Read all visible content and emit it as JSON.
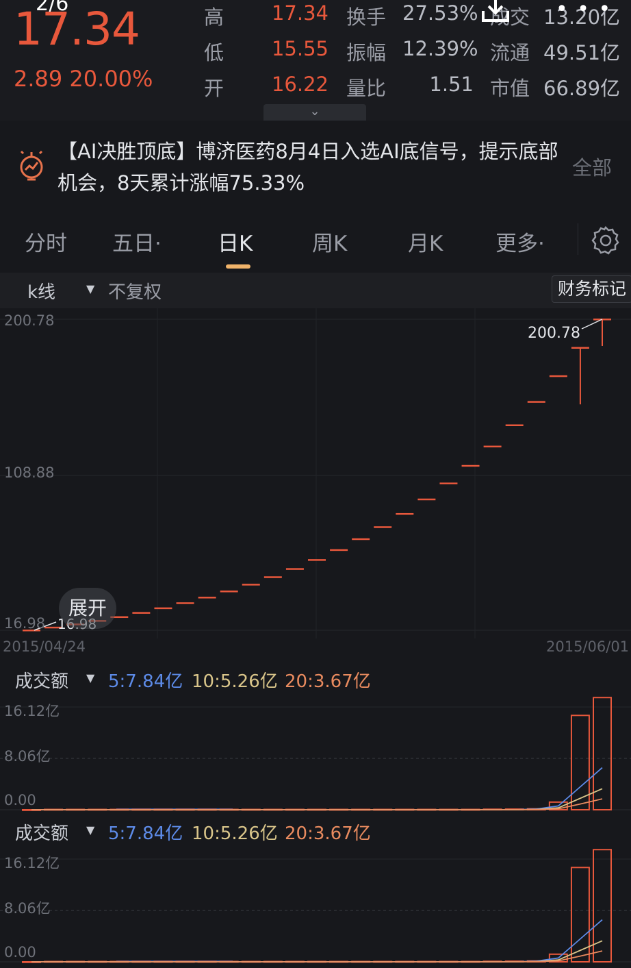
{
  "quote": {
    "page_index": "2/6",
    "price": "17.34",
    "change": "2.89",
    "change_pct": "20.00%",
    "rows": [
      {
        "label": "高",
        "value": "17.34",
        "label2": "换手",
        "value2": "27.53%",
        "label3": "成交",
        "value3": "13.20亿"
      },
      {
        "label": "低",
        "value": "15.55",
        "label2": "振幅",
        "value2": "12.39%",
        "label3": "流通",
        "value3": "49.51亿"
      },
      {
        "label": "开",
        "value": "16.22",
        "label2": "量比",
        "value2": "1.51",
        "label3": "市值",
        "value3": "66.89亿"
      }
    ],
    "expand_glyph": "⌄"
  },
  "icons": {
    "download": "download-icon",
    "more": "more-icon",
    "bulb": "ai-signal-icon",
    "settings": "gear-icon"
  },
  "banner": {
    "text": "【AI决胜顶底】博济医药8月4日入选AI底信号，提示底部机会，8天累计涨幅75.33%",
    "all_label": "全部"
  },
  "tabs": [
    {
      "label": "分时",
      "active": false
    },
    {
      "label": "五日·",
      "active": false
    },
    {
      "label": "日K",
      "active": true
    },
    {
      "label": "周K",
      "active": false
    },
    {
      "label": "月K",
      "active": false
    },
    {
      "label": "更多·",
      "active": false
    }
  ],
  "kline_header": {
    "type_label": "k线",
    "adjust_label": "不复权",
    "finance_mark_label": "财务标记"
  },
  "expand_button": "展开",
  "volume_panels": [
    {
      "label": "成交额",
      "ma5": "5:7.84亿",
      "ma10": "10:5.26亿",
      "ma20": "20:3.67亿",
      "ticks": [
        "16.12亿",
        "8.06亿",
        "0.00"
      ]
    },
    {
      "label": "成交额",
      "ma5": "5:7.84亿",
      "ma10": "10:5.26亿",
      "ma20": "20:3.67亿",
      "ticks": [
        "16.12亿",
        "8.06亿",
        "0.00"
      ]
    }
  ],
  "colors": {
    "up": "#e8583c",
    "accent": "#f0b36a",
    "ma5": "#5d8be8",
    "ma10": "#d9c58a",
    "ma20": "#e98b5f"
  },
  "chart_data": {
    "type": "candlestick",
    "y_ticks": [
      "200.78",
      "108.88",
      "16.98"
    ],
    "ylim": [
      16.98,
      200.78
    ],
    "x_labels": [
      "2015/04/24",
      "2015/06/01"
    ],
    "max_label": "200.78",
    "min_label": "16.98",
    "candles": [
      {
        "o": 16.98,
        "h": 16.98,
        "l": 16.98,
        "c": 16.98
      },
      {
        "o": 18.68,
        "h": 18.68,
        "l": 18.68,
        "c": 18.68
      },
      {
        "o": 20.55,
        "h": 20.55,
        "l": 20.55,
        "c": 20.55
      },
      {
        "o": 22.6,
        "h": 22.6,
        "l": 22.6,
        "c": 22.6
      },
      {
        "o": 24.86,
        "h": 24.86,
        "l": 24.86,
        "c": 24.86
      },
      {
        "o": 27.35,
        "h": 27.35,
        "l": 27.35,
        "c": 27.35
      },
      {
        "o": 30.08,
        "h": 30.08,
        "l": 30.08,
        "c": 30.08
      },
      {
        "o": 33.09,
        "h": 33.09,
        "l": 33.09,
        "c": 33.09
      },
      {
        "o": 36.4,
        "h": 36.4,
        "l": 36.4,
        "c": 36.4
      },
      {
        "o": 40.04,
        "h": 40.04,
        "l": 40.04,
        "c": 40.04
      },
      {
        "o": 44.04,
        "h": 44.04,
        "l": 44.04,
        "c": 44.04
      },
      {
        "o": 48.45,
        "h": 48.45,
        "l": 48.45,
        "c": 48.45
      },
      {
        "o": 53.29,
        "h": 53.29,
        "l": 53.29,
        "c": 53.29
      },
      {
        "o": 58.62,
        "h": 58.62,
        "l": 58.62,
        "c": 58.62
      },
      {
        "o": 64.48,
        "h": 64.48,
        "l": 64.48,
        "c": 64.48
      },
      {
        "o": 70.93,
        "h": 70.93,
        "l": 70.93,
        "c": 70.93
      },
      {
        "o": 78.02,
        "h": 78.02,
        "l": 78.02,
        "c": 78.02
      },
      {
        "o": 85.83,
        "h": 85.83,
        "l": 85.83,
        "c": 85.83
      },
      {
        "o": 94.41,
        "h": 94.41,
        "l": 94.41,
        "c": 94.41
      },
      {
        "o": 103.85,
        "h": 103.85,
        "l": 103.85,
        "c": 103.85
      },
      {
        "o": 114.24,
        "h": 114.24,
        "l": 114.24,
        "c": 114.24
      },
      {
        "o": 125.66,
        "h": 125.66,
        "l": 125.66,
        "c": 125.66
      },
      {
        "o": 138.23,
        "h": 138.23,
        "l": 138.23,
        "c": 138.23
      },
      {
        "o": 152.05,
        "h": 152.05,
        "l": 152.05,
        "c": 152.05
      },
      {
        "o": 167.25,
        "h": 167.25,
        "l": 167.25,
        "c": 167.25
      },
      {
        "o": 183.98,
        "h": 183.98,
        "l": 150.5,
        "c": 183.98
      },
      {
        "o": 200.78,
        "h": 200.78,
        "l": 185.0,
        "c": 200.78
      }
    ],
    "volume": {
      "ylim": [
        0,
        16.12
      ],
      "unit": "亿",
      "bars": [
        0,
        0.05,
        0.05,
        0.05,
        0.05,
        0.05,
        0.05,
        0.05,
        0.05,
        0.05,
        0.05,
        0.05,
        0.05,
        0.05,
        0.05,
        0.05,
        0.05,
        0.05,
        0.05,
        0.05,
        0.05,
        0.08,
        0.1,
        0.15,
        1.2,
        14.8,
        17.6
      ],
      "ma5": [
        0,
        0,
        0,
        0,
        0,
        0,
        0,
        0,
        0,
        0,
        0,
        0,
        0,
        0,
        0,
        0,
        0,
        0,
        0,
        0,
        0,
        0,
        0,
        0.1,
        0.6,
        3.6,
        6.6
      ],
      "ma10": [
        0,
        0,
        0,
        0,
        0,
        0,
        0,
        0,
        0,
        0,
        0,
        0,
        0,
        0,
        0,
        0,
        0,
        0,
        0,
        0,
        0,
        0,
        0,
        0.05,
        0.3,
        1.8,
        3.3
      ],
      "ma20": [
        0,
        0,
        0,
        0,
        0,
        0,
        0,
        0,
        0,
        0,
        0,
        0,
        0,
        0,
        0,
        0,
        0,
        0,
        0,
        0,
        0,
        0,
        0,
        0.03,
        0.15,
        0.9,
        1.7
      ]
    }
  }
}
